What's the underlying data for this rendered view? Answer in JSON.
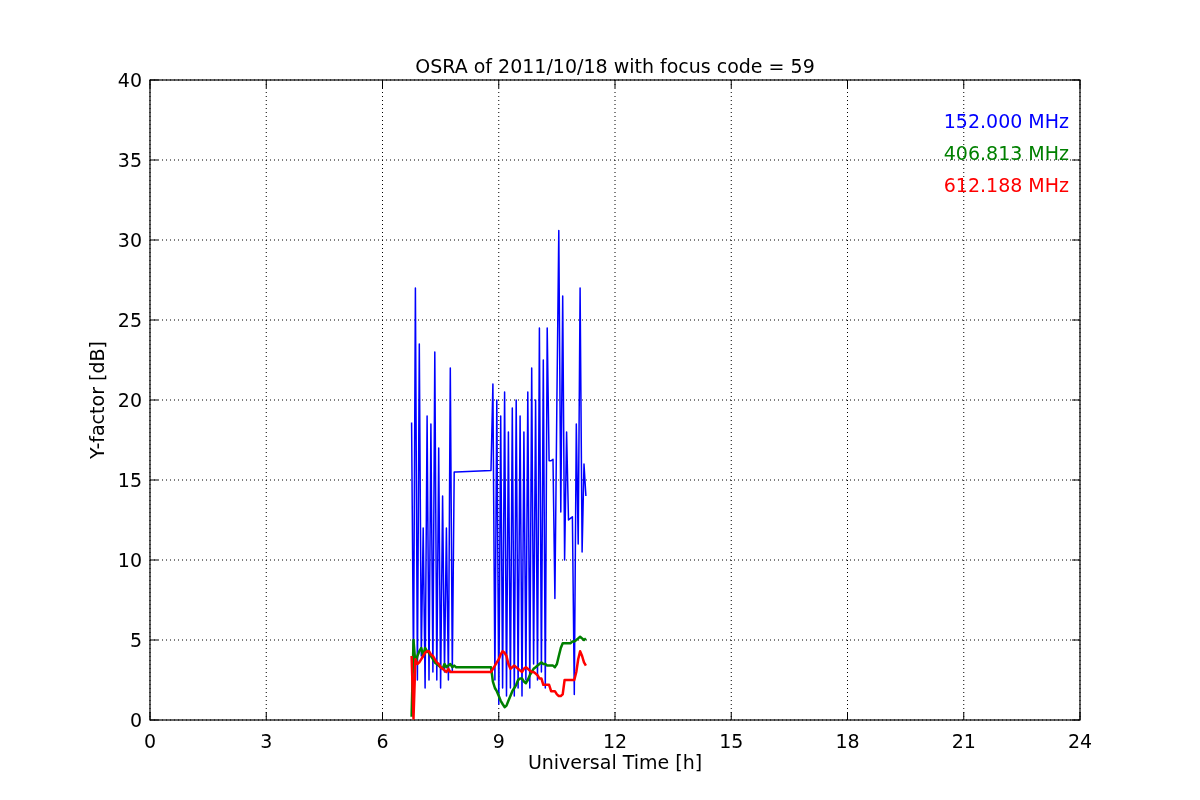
{
  "chart_data": {
    "type": "line",
    "title": "OSRA of 2011/10/18 with focus code = 59",
    "xlabel": "Universal Time [h]",
    "ylabel": "Y-factor [dB]",
    "grid": true,
    "xlim": [
      0,
      24
    ],
    "ylim": [
      0,
      40
    ],
    "xticks": [
      0,
      3,
      6,
      9,
      12,
      15,
      18,
      21,
      24
    ],
    "yticks": [
      0,
      5,
      10,
      15,
      20,
      25,
      30,
      35,
      40
    ],
    "x": [
      6.75,
      6.8,
      6.85,
      6.9,
      6.95,
      7.0,
      7.05,
      7.1,
      7.15,
      7.2,
      7.25,
      7.3,
      7.35,
      7.4,
      7.45,
      7.5,
      7.55,
      7.6,
      7.65,
      7.7,
      7.75,
      7.8,
      7.85,
      7.9,
      8.8,
      8.85,
      8.9,
      8.95,
      9.0,
      9.05,
      9.1,
      9.15,
      9.2,
      9.25,
      9.3,
      9.35,
      9.4,
      9.45,
      9.5,
      9.55,
      9.6,
      9.65,
      9.7,
      9.75,
      9.8,
      9.85,
      9.9,
      9.95,
      10.0,
      10.05,
      10.1,
      10.15,
      10.2,
      10.25,
      10.3,
      10.35,
      10.4,
      10.45,
      10.5,
      10.55,
      10.6,
      10.65,
      10.7,
      10.75,
      10.8,
      10.85,
      10.9,
      10.95,
      11.0,
      11.05,
      11.1,
      11.15,
      11.2,
      11.25
    ],
    "series": [
      {
        "name": "152.000 MHz",
        "color": "#0000ff",
        "values": [
          18.6,
          3,
          27,
          2.5,
          23.5,
          4,
          12,
          2,
          19,
          2.5,
          18.5,
          3,
          23,
          2.5,
          17,
          2,
          14,
          3,
          12,
          2.5,
          22,
          3,
          15.5,
          15.5,
          15.6,
          21,
          2.5,
          20,
          1,
          19,
          2,
          20.5,
          1.5,
          18,
          2,
          19.5,
          1.5,
          20,
          2,
          19,
          1.5,
          18,
          2.5,
          20.5,
          2,
          22,
          3.5,
          20,
          2.5,
          24.5,
          3,
          22.5,
          2,
          24.5,
          16.2,
          16.2,
          16.3,
          7.6,
          20,
          30.6,
          13,
          26.5,
          10,
          18,
          12.5,
          12.6,
          12.7,
          1.6,
          18.5,
          11,
          27,
          10.5,
          16,
          14
        ]
      },
      {
        "name": "406.813 MHz",
        "color": "#008000",
        "values": [
          0.2,
          5,
          3.5,
          4,
          4.3,
          4.5,
          4,
          4.5,
          4.3,
          4.2,
          4,
          3.8,
          3.6,
          3.5,
          3.4,
          3.3,
          3.2,
          3.5,
          3.3,
          3.4,
          3.5,
          3.3,
          3.4,
          3.3,
          3.3,
          2.4,
          2,
          1.8,
          1.5,
          1.2,
          1,
          0.8,
          0.9,
          1.2,
          1.5,
          1.8,
          2,
          2.2,
          2.5,
          2.6,
          2.6,
          2.4,
          2.3,
          2.5,
          2.8,
          3,
          3.2,
          3.3,
          3.4,
          3.5,
          3.6,
          3.5,
          3.5,
          3.4,
          3.4,
          3.4,
          3.4,
          3.3,
          3.5,
          4,
          4.5,
          4.8,
          4.8,
          4.8,
          4.8,
          4.8,
          4.9,
          4.9,
          5,
          5.1,
          5.2,
          5.1,
          5,
          5.1
        ]
      },
      {
        "name": "612.188 MHz",
        "color": "#ff0000",
        "values": [
          4,
          0.1,
          3.8,
          3.5,
          3.6,
          3.8,
          4,
          4.2,
          4.3,
          4.3,
          4.1,
          4,
          3.8,
          3.6,
          3.5,
          3.3,
          3.2,
          3.1,
          3,
          3.2,
          3,
          3,
          3,
          3,
          3,
          3.2,
          3.4,
          3.6,
          3.8,
          4.1,
          4.3,
          4.2,
          4,
          3.5,
          3.2,
          3.3,
          3.4,
          3.3,
          3.2,
          3.1,
          3,
          3.2,
          3.3,
          3.2,
          3.1,
          3,
          3,
          2.9,
          2.8,
          2.6,
          2.6,
          2.2,
          2.2,
          2.2,
          2.2,
          1.8,
          1.8,
          1.8,
          1.6,
          1.5,
          1.5,
          1.6,
          2.5,
          2.5,
          2.5,
          2.5,
          2.5,
          2.5,
          3,
          3.8,
          4.3,
          4,
          3.6,
          3.4
        ]
      }
    ]
  }
}
